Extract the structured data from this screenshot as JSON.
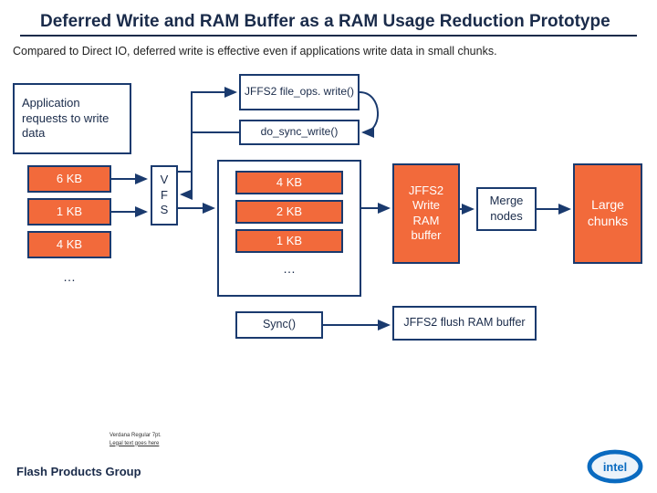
{
  "title": "Deferred Write and RAM Buffer as a RAM Usage Reduction Prototype",
  "subtitle": "Compared to Direct IO, deferred write is effective even if applications write data in small chunks.",
  "app_box": "Application requests to write data",
  "sizes": [
    "6 KB",
    "1 KB",
    "4 KB",
    "…"
  ],
  "vfs": "V\nF\nS",
  "jffs2_write_call": "JFFS2 file_ops. write()",
  "do_sync": "do_sync_write()",
  "buffer_sizes": [
    "4 KB",
    "2 KB",
    "1 KB",
    "…"
  ],
  "sync_call": "Sync()",
  "ram_buffer": "JFFS2 Write RAM buffer",
  "merge": "Merge nodes",
  "large_chunks": "Large chunks",
  "flush": "JFFS2 flush RAM buffer",
  "footer_legal_1": "Verdana Regular 7pt.",
  "footer_legal_2": "Legal text goes here",
  "footer_group": "Flash Products Group"
}
